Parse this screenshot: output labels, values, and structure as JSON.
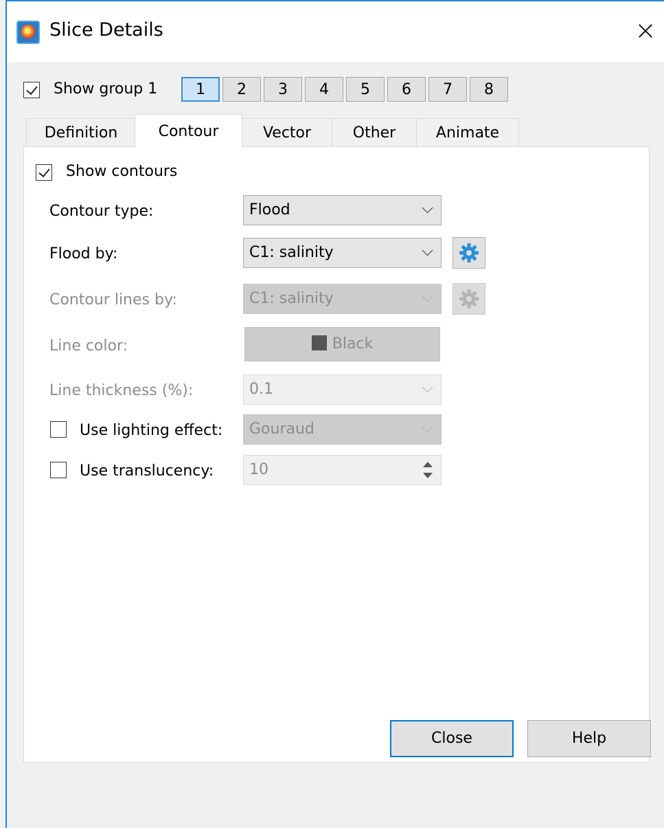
{
  "window": {
    "title": "Slice Details"
  },
  "group": {
    "show_label": "Show group 1",
    "show_checked": true,
    "buttons": [
      "1",
      "2",
      "3",
      "4",
      "5",
      "6",
      "7",
      "8"
    ],
    "active": "1"
  },
  "tabs": [
    "Definition",
    "Contour",
    "Vector",
    "Other",
    "Animate"
  ],
  "active_tab": "Contour",
  "contour": {
    "show_contours_label": "Show contours",
    "show_contours_checked": true,
    "contour_type_label": "Contour type:",
    "contour_type_value": "Flood",
    "flood_by_label": "Flood by:",
    "flood_by_value": "C1: salinity",
    "contour_lines_by_label": "Contour lines by:",
    "contour_lines_by_value": "C1: salinity",
    "line_color_label": "Line color:",
    "line_color_value": "Black",
    "line_thickness_label": "Line thickness (%):",
    "line_thickness_value": "0.1",
    "lighting_label": "Use lighting effect:",
    "lighting_checked": false,
    "lighting_value": "Gouraud",
    "translucency_label": "Use translucency:",
    "translucency_checked": false,
    "translucency_value": "10"
  },
  "footer": {
    "close_label": "Close",
    "help_label": "Help"
  },
  "colors": {
    "accent": "#0078d7",
    "active_group_bg": "#cce4f7",
    "gear_icon": "#2a8fd9"
  },
  "icons": [
    "app-icon",
    "close-icon",
    "gear-icon",
    "chevron-down-icon",
    "spin-up-icon",
    "spin-down-icon"
  ]
}
